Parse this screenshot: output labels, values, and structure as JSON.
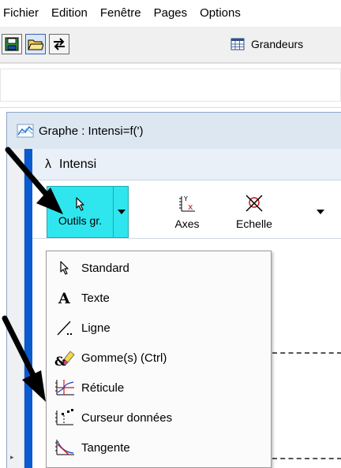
{
  "menubar": {
    "items": [
      "Fichier",
      "Edition",
      "Fenêtre",
      "Pages",
      "Options"
    ]
  },
  "toolbar": {
    "buttons": [
      {
        "icon": "save-icon"
      },
      {
        "icon": "open-folder-icon"
      },
      {
        "icon": "swap-arrows-icon"
      }
    ],
    "grandeurs_label": "Grandeurs",
    "grandeurs_icon": "table-icon"
  },
  "graph_window": {
    "title": "Graphe : Intensi=f(')",
    "subtitle": "Intensi",
    "subtitle_symbol": "λ",
    "tools": [
      {
        "label": "Outils gr.",
        "icon": "cursor-icon",
        "active": true,
        "accent": "#2fe6ee"
      },
      {
        "label": "Axes",
        "icon": "axes-icon"
      },
      {
        "label": "Echelle",
        "icon": "scale-icon"
      }
    ]
  },
  "dropdown": {
    "items": [
      {
        "label": "Standard",
        "icon": "cursor-icon"
      },
      {
        "label": "Texte",
        "icon": "text-icon"
      },
      {
        "label": "Ligne",
        "icon": "line-icon"
      },
      {
        "label": "Gomme(s) (Ctrl)",
        "icon": "eraser-icon"
      },
      {
        "label": "Réticule",
        "icon": "reticle-icon"
      },
      {
        "label": "Curseur données",
        "icon": "data-cursor-icon"
      },
      {
        "label": "Tangente",
        "icon": "tangent-icon"
      }
    ]
  },
  "colors": {
    "accent_cyan": "#2fe6ee",
    "window_blue": "#0a5ad0",
    "title_bg": "#dde7f2"
  }
}
